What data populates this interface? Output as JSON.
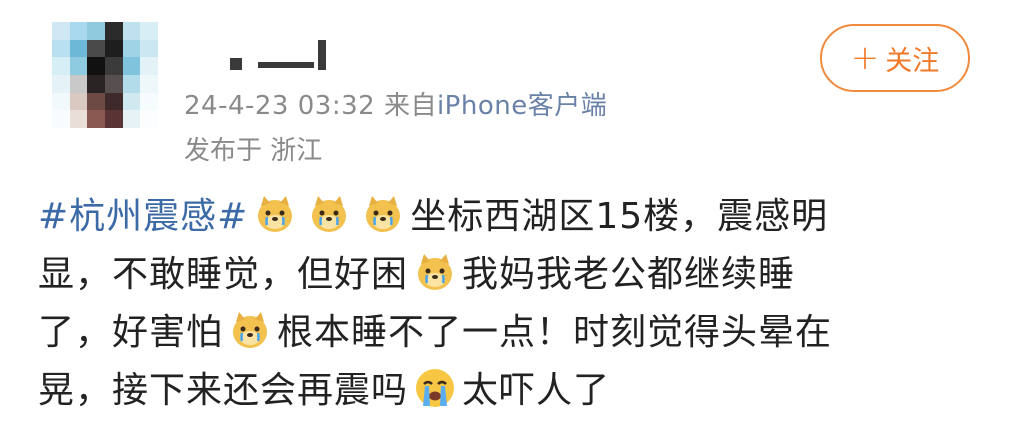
{
  "post": {
    "meta": {
      "timestamp": "24-4-23 03:32",
      "from_label": "来自",
      "source": "iPhone客户端"
    },
    "location": "发布于 浙江",
    "follow_button": {
      "plus": "+",
      "label": "关注"
    },
    "content": {
      "topic": "#杭州震感#",
      "line1": "坐标西湖区15楼，震感明",
      "line2a": "显，不敢睡觉，但好困",
      "line2b": "我妈我老公都继续睡",
      "line3a": "了，好害怕",
      "line3b": "根本睡不了一点！时刻觉得头晕在",
      "line4a": "晃，接下来还会再震吗",
      "line4b": "太吓人了"
    },
    "icons": {
      "emoji_doge_cry": "doge-crying-emoji",
      "emoji_crying": "loudly-crying-emoji"
    },
    "colors": {
      "topic": "#3c6aa6",
      "follow": "#f07a28",
      "meta": "#8a8a8a",
      "source": "#6b82a8"
    }
  }
}
